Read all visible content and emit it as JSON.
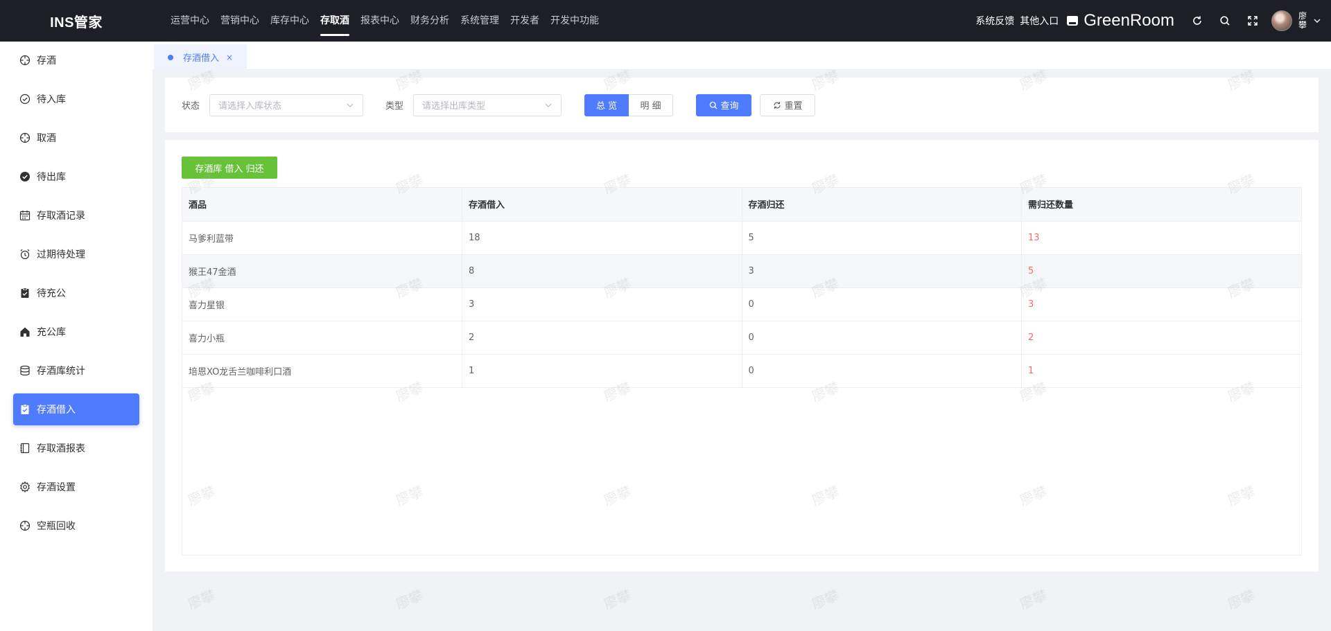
{
  "app": {
    "logo": "INS管家"
  },
  "topnav": [
    {
      "label": "运营中心",
      "active": false
    },
    {
      "label": "营销中心",
      "active": false
    },
    {
      "label": "库存中心",
      "active": false
    },
    {
      "label": "存取酒",
      "active": true
    },
    {
      "label": "报表中心",
      "active": false
    },
    {
      "label": "财务分析",
      "active": false
    },
    {
      "label": "系统管理",
      "active": false
    },
    {
      "label": "开发者",
      "active": false
    },
    {
      "label": "开发中功能",
      "active": false
    }
  ],
  "header": {
    "feedback": "系统反馈",
    "other_entry": "其他入口",
    "store_name": "GreenRoom",
    "icons": [
      "refresh-icon",
      "search-icon",
      "fullscreen-icon"
    ],
    "user_name": "廖攀"
  },
  "sidebar": [
    {
      "label": "存酒",
      "icon": "crosshair-icon",
      "active": false
    },
    {
      "label": "待入库",
      "icon": "check-circle-icon",
      "active": false
    },
    {
      "label": "取酒",
      "icon": "crosshair-icon",
      "active": false
    },
    {
      "label": "待出库",
      "icon": "check-filled-icon",
      "active": false
    },
    {
      "label": "存取酒记录",
      "icon": "calendar-icon",
      "active": false
    },
    {
      "label": "过期待处理",
      "icon": "alarm-icon",
      "active": false
    },
    {
      "label": "待充公",
      "icon": "clipboard-check-icon",
      "active": false
    },
    {
      "label": "充公库",
      "icon": "home-icon",
      "active": false
    },
    {
      "label": "存酒库统计",
      "icon": "database-icon",
      "active": false
    },
    {
      "label": "存酒借入",
      "icon": "clipboard-check-icon",
      "active": true
    },
    {
      "label": "存取酒报表",
      "icon": "notebook-icon",
      "active": false
    },
    {
      "label": "存酒设置",
      "icon": "gear-icon",
      "active": false
    },
    {
      "label": "空瓶回收",
      "icon": "crosshair-icon",
      "active": false
    }
  ],
  "tab": {
    "label": "存酒借入",
    "close": "×"
  },
  "filters": {
    "status_label": "状态",
    "status_placeholder": "请选择入库状态",
    "type_label": "类型",
    "type_placeholder": "请选择出库类型",
    "overview": "总 览",
    "detail": "明 细",
    "query": "查询",
    "reset": "重置"
  },
  "action": {
    "green_button": "存酒库 借入 归还"
  },
  "table": {
    "columns": [
      "酒品",
      "存酒借入",
      "存酒归还",
      "需归还数量"
    ],
    "rows": [
      [
        "马爹利蓝带",
        "18",
        "5",
        "13"
      ],
      [
        "猴王47金酒",
        "8",
        "3",
        "5"
      ],
      [
        "喜力星银",
        "3",
        "0",
        "3"
      ],
      [
        "喜力小瓶",
        "2",
        "0",
        "2"
      ],
      [
        "培恩XO龙舌兰咖啡利口酒",
        "1",
        "0",
        "1"
      ]
    ]
  },
  "watermark": "廖攀",
  "colors": {
    "accent": "#4f7bff",
    "topbar": "#1d1e26",
    "green": "#67c23a",
    "danger": "#f56c6c"
  }
}
